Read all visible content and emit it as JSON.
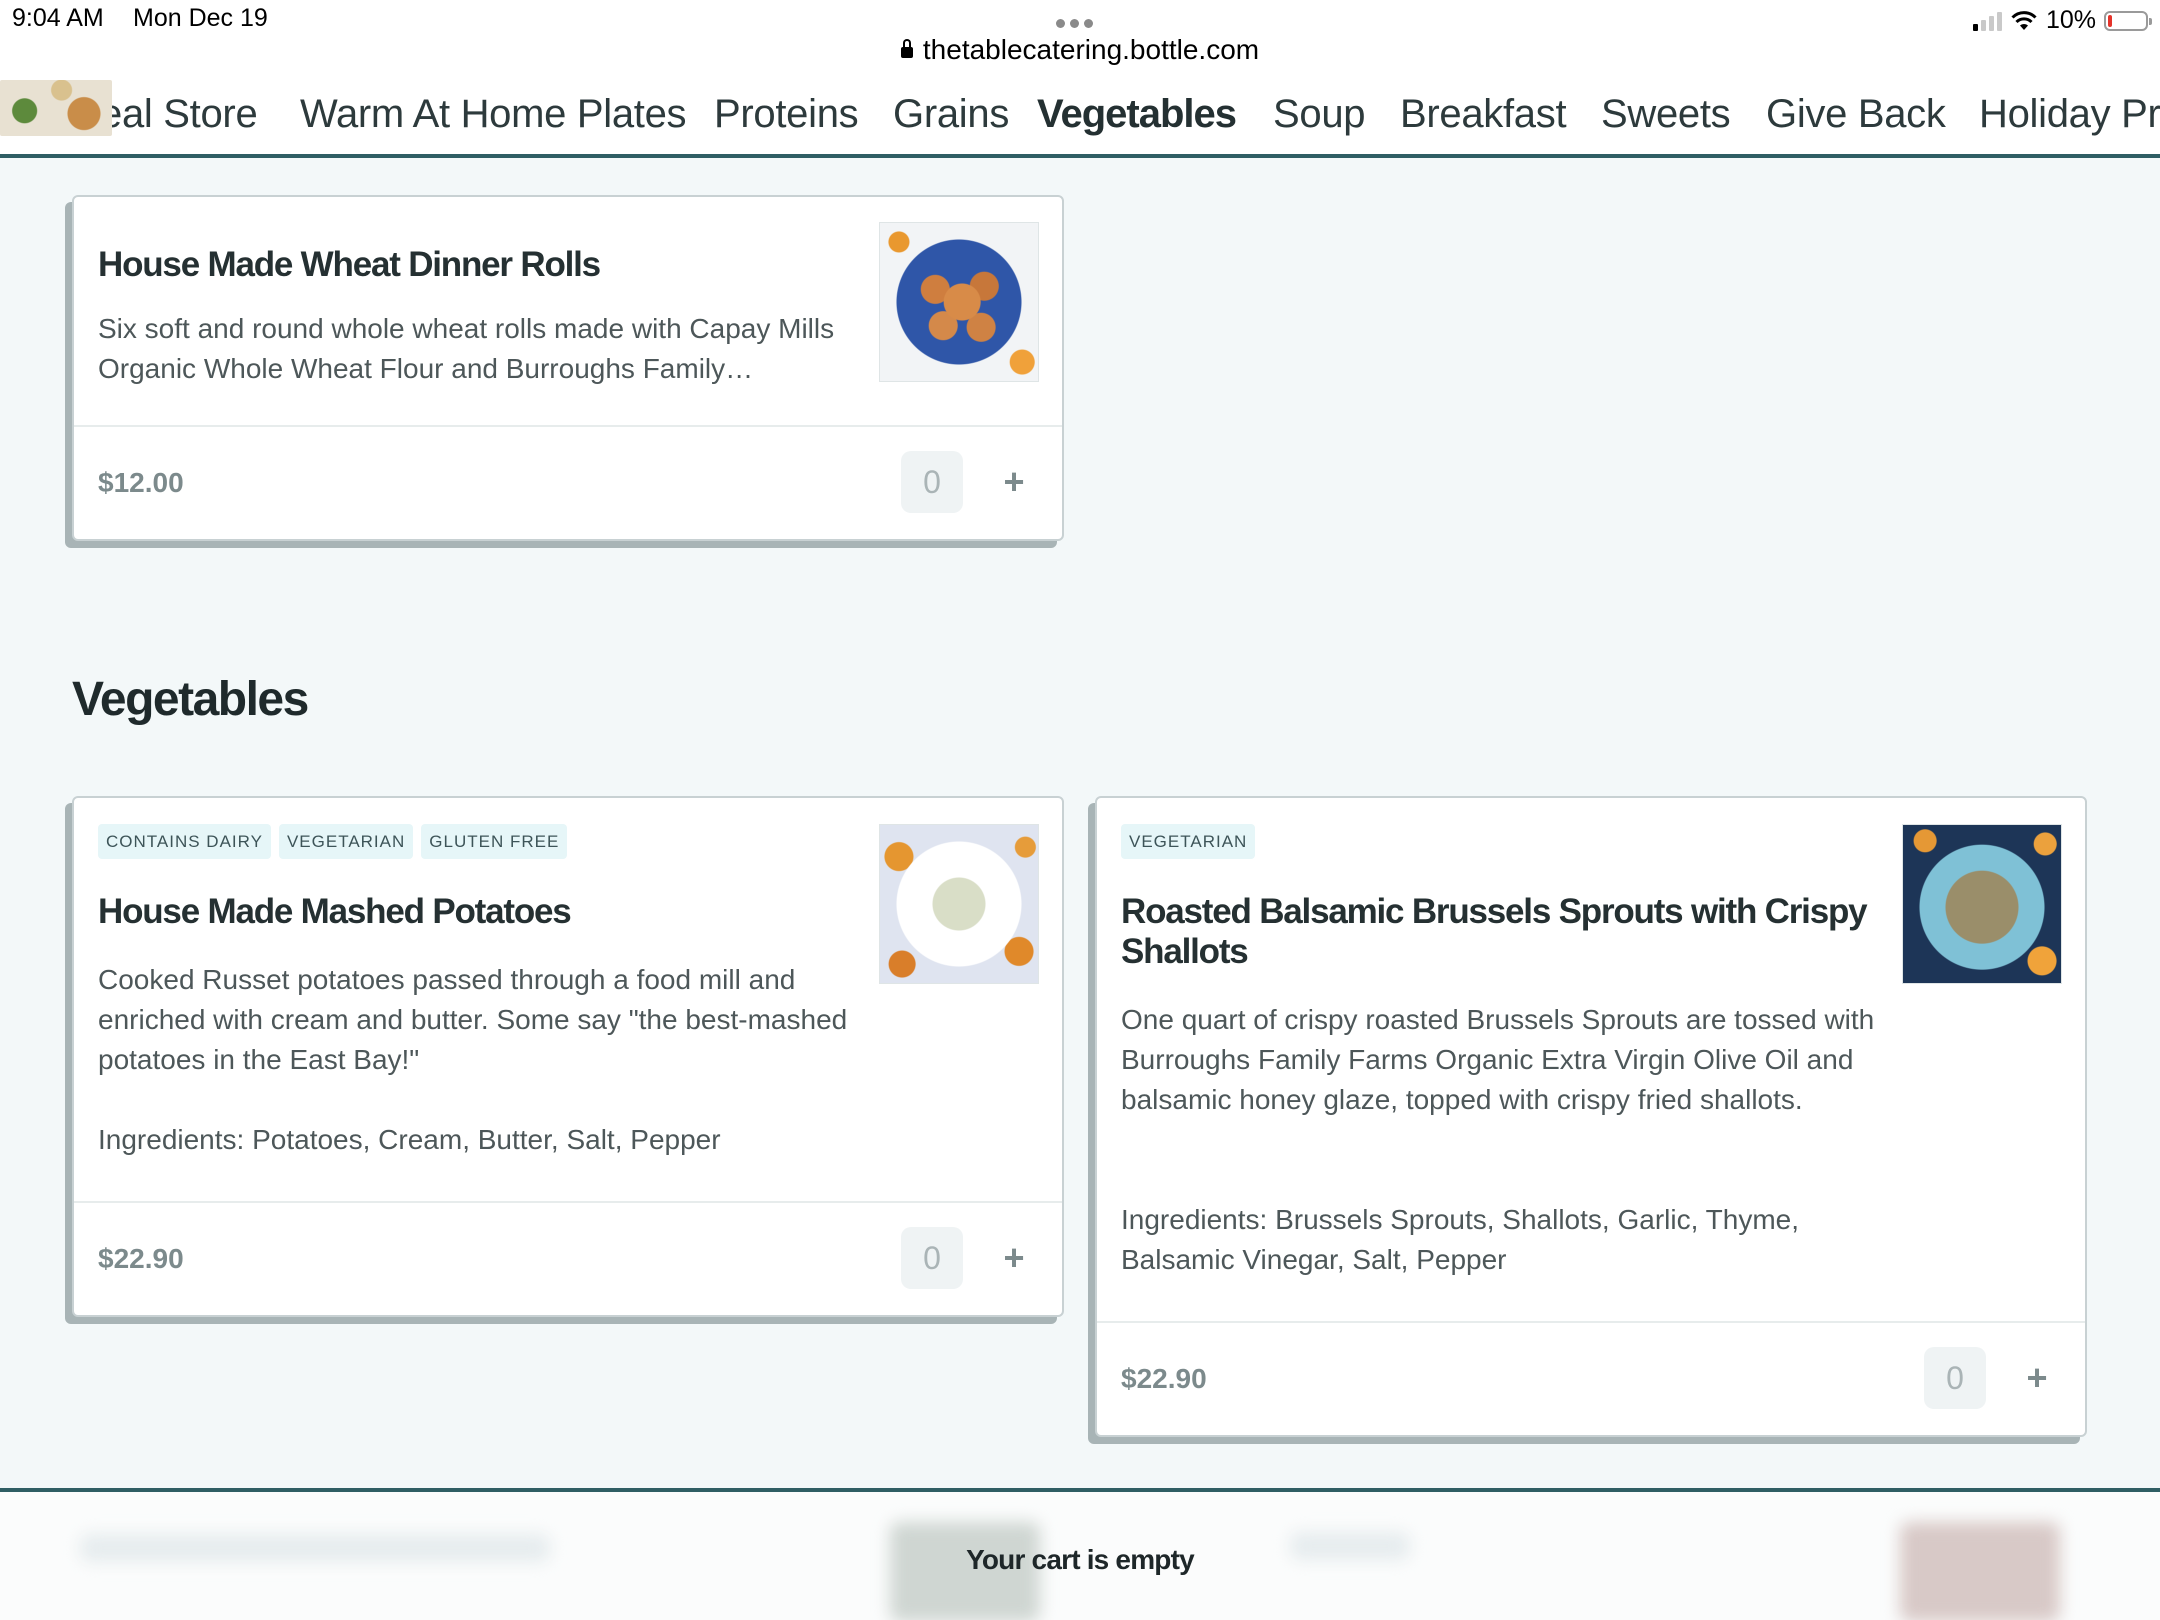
{
  "status_bar": {
    "time": "9:04 AM",
    "date": "Mon Dec 19",
    "battery": "10%",
    "battery_level": 0.1,
    "url": "thetablecatering.bottle.com"
  },
  "nav": {
    "items": [
      {
        "label": "eal Store"
      },
      {
        "label": "Warm At Home Plates"
      },
      {
        "label": "Proteins"
      },
      {
        "label": "Grains"
      },
      {
        "label": "Vegetables",
        "active": true
      },
      {
        "label": "Soup"
      },
      {
        "label": "Breakfast"
      },
      {
        "label": "Sweets"
      },
      {
        "label": "Give Back"
      },
      {
        "label": "Holiday Pro"
      }
    ]
  },
  "cards": {
    "rolls": {
      "title": "House Made Wheat Dinner Rolls",
      "description": "Six soft and round whole wheat rolls made with Capay Mills Organic Whole Wheat Flour and Burroughs Family…",
      "price": "$12.00",
      "quantity": "0",
      "add_label": "+"
    },
    "potatoes": {
      "tags": [
        "CONTAINS DAIRY",
        "VEGETARIAN",
        "GLUTEN FREE"
      ],
      "title": "House Made Mashed Potatoes",
      "description": "Cooked Russet potatoes passed through a food mill and enriched with cream and butter. Some say \"the best-mashed potatoes in the East Bay!\"",
      "ingredients": "Ingredients: Potatoes, Cream, Butter, Salt, Pepper",
      "price": "$22.90",
      "quantity": "0",
      "add_label": "+"
    },
    "sprouts": {
      "tags": [
        "VEGETARIAN"
      ],
      "title": "Roasted Balsamic Brussels Sprouts with Crispy Shallots",
      "description": "One quart of crispy roasted Brussels Sprouts are tossed with Burroughs Family Farms Organic Extra Virgin Olive Oil and balsamic honey glaze, topped with crispy fried shallots.",
      "ingredients": "Ingredients: Brussels Sprouts, Shallots, Garlic, Thyme, Balsamic Vinegar, Salt, Pepper",
      "price": "$22.90",
      "quantity": "0",
      "add_label": "+"
    }
  },
  "section": {
    "heading": "Vegetables"
  },
  "cart": {
    "status": "Your cart is empty"
  },
  "colors": {
    "page_background": "#f3f8f9",
    "nav_accent": "#2f5e64",
    "tag_background": "#e6f6f8",
    "battery_low": "#e5332a"
  },
  "icons": [
    "lock-icon",
    "signal-icon",
    "wifi-icon",
    "battery-icon",
    "plus-icon"
  ]
}
